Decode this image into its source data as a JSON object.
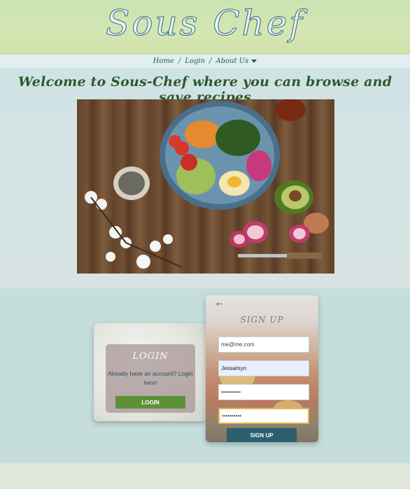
{
  "header": {
    "logo_text": "Sous Chef"
  },
  "nav": {
    "home": "Home",
    "login": "Login",
    "about": "About Us",
    "separator": "/"
  },
  "hero": {
    "welcome": "Welcome to Sous-Chef where you can browse and save recipes"
  },
  "login": {
    "title": "LOGIN",
    "prompt": "Already have an account? Login here!",
    "button": "LOGIN"
  },
  "signup": {
    "title": "SIGN UP",
    "email_value": "me@me.com",
    "name_value": "Jessamyn",
    "password_value": "••••••••••",
    "confirm_password_value": "••••••••••",
    "button": "SIGN UP"
  },
  "colors": {
    "accent_green": "#5c9138",
    "accent_teal": "#2b5f6e",
    "focus_border": "#e5b54f"
  }
}
